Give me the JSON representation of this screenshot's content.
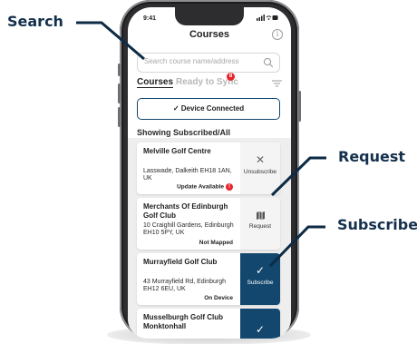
{
  "callouts": {
    "search": "Search",
    "request": "Request",
    "subscribe": "Subscribe"
  },
  "status_bar": {
    "time": "9:41",
    "icons": "signal-wifi-battery"
  },
  "header": {
    "title": "Courses",
    "info_icon": "info-icon"
  },
  "search": {
    "placeholder": "Search course name/address",
    "value": ""
  },
  "tabs": [
    {
      "label": "Courses",
      "active": true
    },
    {
      "label": "Ready to Sync",
      "active": false,
      "badge": "8"
    }
  ],
  "device_button": {
    "check": "✓",
    "label": "Device Connected"
  },
  "section_title": "Showing Subscribed/All",
  "courses": [
    {
      "name": "Melville Golf Centre",
      "address": "Lasswade, Dalkeith EH18 1AN, UK",
      "status": "Update Available",
      "alert": "!",
      "action_glyph": "✕",
      "action_label": "Unsubscribe",
      "action_style": "light"
    },
    {
      "name": "Merchants Of Edinburgh Golf Club",
      "address": "10 Craighill Gardens, Edinburgh EH10 5PY, UK",
      "status": "Not Mapped",
      "action_glyph": "map-icon",
      "action_label": "Request",
      "action_style": "light"
    },
    {
      "name": "Murrayfield Golf Club",
      "address": "43 Murrayfield Rd, Edinburgh EH12 6EU, UK",
      "status": "On Device",
      "action_glyph": "✓",
      "action_label": "Subscribe",
      "action_style": "dark"
    },
    {
      "name": "Musselburgh Golf Club Monktonhall",
      "address": "",
      "status": "",
      "action_glyph": "✓",
      "action_label": "",
      "action_style": "dark"
    }
  ],
  "colors": {
    "navy": "#14476e",
    "alert_red": "#e8242c",
    "callout_text": "#14304d"
  }
}
